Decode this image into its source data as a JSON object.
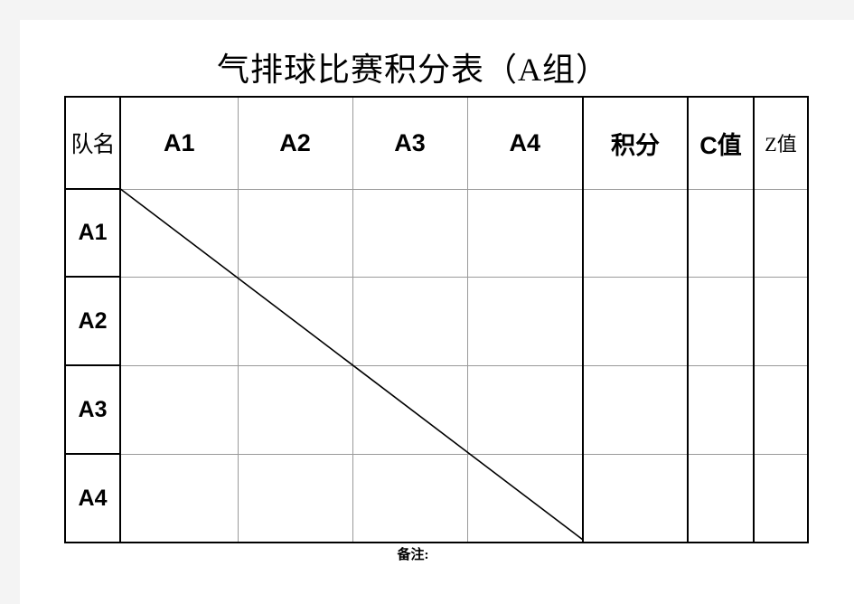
{
  "document": {
    "title": "气排球比赛积分表（A组）",
    "footnote": "备注:"
  },
  "table": {
    "header": {
      "team_name": "队名",
      "columns": [
        "A1",
        "A2",
        "A3",
        "A4",
        "积分",
        "C值",
        "Z值"
      ]
    },
    "rows": [
      {
        "team": "A1",
        "cells": [
          "",
          "",
          "",
          "",
          "",
          "",
          ""
        ]
      },
      {
        "team": "A2",
        "cells": [
          "",
          "",
          "",
          "",
          "",
          "",
          ""
        ]
      },
      {
        "team": "A3",
        "cells": [
          "",
          "",
          "",
          "",
          "",
          "",
          ""
        ]
      },
      {
        "team": "A4",
        "cells": [
          "",
          "",
          "",
          "",
          "",
          "",
          ""
        ]
      }
    ],
    "diagonal": {
      "description": "strike-through diagonal across self-match cells",
      "color": "#000000"
    }
  },
  "colors": {
    "page_background": "#ffffff",
    "canvas_background": "#f4f4f4",
    "text": "#000000",
    "grid_line": "#9a9a9a",
    "frame_line": "#000000"
  }
}
